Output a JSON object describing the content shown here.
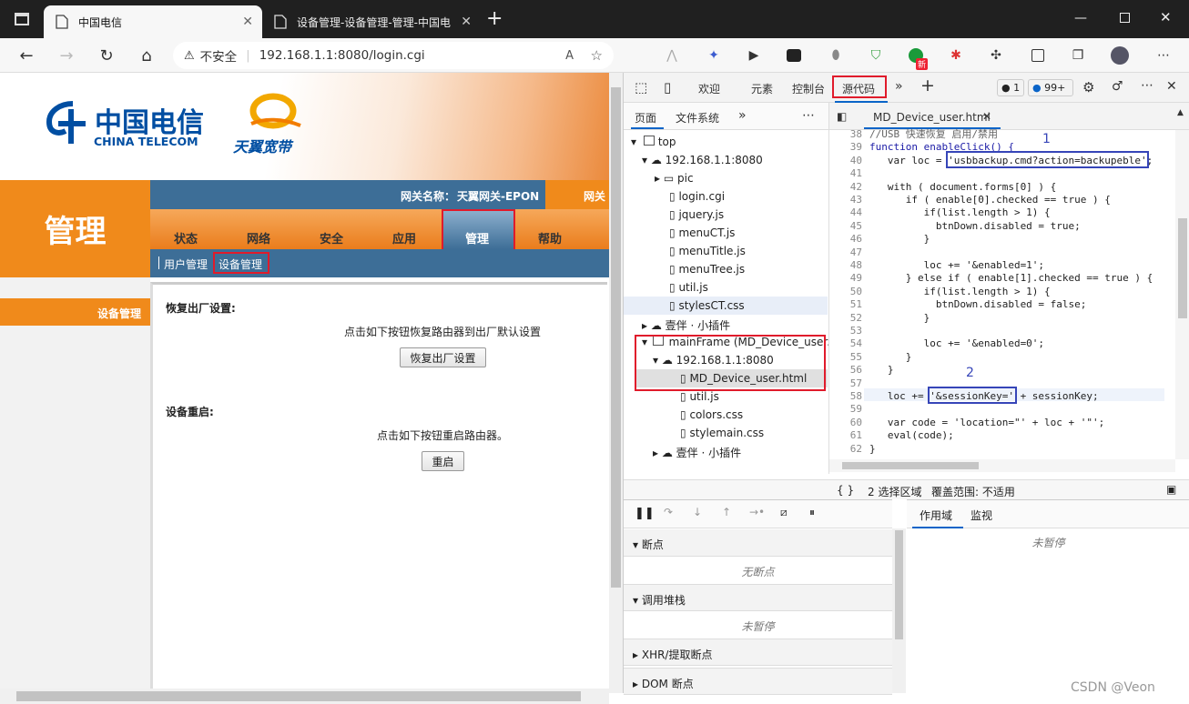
{
  "browser": {
    "tabs": [
      {
        "title": "中国电信"
      },
      {
        "title": "设备管理-设备管理-管理-中国电"
      }
    ],
    "security_label": "不安全",
    "url": "192.168.1.1:8080/login.cgi",
    "read_aloud": "A",
    "ext_badge": "新"
  },
  "page": {
    "logo_cn": "中国电信",
    "logo_en": "CHINA TELECOM",
    "logo2": "天翼宽带",
    "side_title": "管理",
    "gateway_label": "网关名称：",
    "gateway_name": "天翼网关-EPON",
    "gateway_label2": "网关",
    "menu": [
      "状态",
      "网络",
      "安全",
      "应用",
      "管理",
      "帮助"
    ],
    "submenu": [
      "用户管理",
      "设备管理"
    ],
    "sidebar_item": "设备管理",
    "factory_title": "恢复出厂设置:",
    "factory_desc": "点击如下按钮恢复路由器到出厂默认设置",
    "factory_btn": "恢复出厂设置",
    "reboot_title": "设备重启:",
    "reboot_desc": "点击如下按钮重启路由器。",
    "reboot_btn": "重启"
  },
  "devtools": {
    "tabs": [
      "欢迎",
      "元素",
      "控制台",
      "源代码"
    ],
    "error_count": "1",
    "msg_count": "99+",
    "nav_tabs": [
      "页面",
      "文件系统"
    ],
    "tree": [
      "top",
      "192.168.1.1:8080",
      "pic",
      "login.cgi",
      "jquery.js",
      "menuCT.js",
      "menuTitle.js",
      "menuTree.js",
      "util.js",
      "stylesCT.css",
      "壹伴 · 小插件",
      "mainFrame (MD_Device_user.html)",
      "192.168.1.1:8080",
      "MD_Device_user.html",
      "util.js",
      "colors.css",
      "stylemain.css",
      "壹伴 · 小插件"
    ],
    "file_tab": "MD_Device_user.html",
    "line_numbers": [
      "38",
      "39",
      "40",
      "41",
      "42",
      "43",
      "44",
      "45",
      "46",
      "47",
      "48",
      "49",
      "50",
      "51",
      "52",
      "53",
      "54",
      "55",
      "56",
      "57",
      "58",
      "59",
      "60",
      "61",
      "62"
    ],
    "code_lines": [
      "//USB 快速恢复 启用/禁用",
      "function enableClick() {",
      "   var loc = 'usbbackup.cmd?action=backupeble';",
      "",
      "   with ( document.forms[0] ) {",
      "      if ( enable[0].checked == true ) {",
      "         if(list.length > 1) {",
      "           btnDown.disabled = true;",
      "         }",
      "",
      "         loc += '&enabled=1';",
      "      } else if ( enable[1].checked == true ) {",
      "         if(list.length > 1) {",
      "           btnDown.disabled = false;",
      "         }",
      "",
      "         loc += '&enabled=0';",
      "      }",
      "   }",
      "",
      "   loc += '&sessionKey=' + sessionKey;",
      "",
      "   var code = 'location=\"' + loc + '\"';",
      "   eval(code);",
      "}"
    ],
    "annotation1": "1",
    "annotation2": "2",
    "status_braces": "{ }",
    "status_selection": "2 选择区域",
    "status_coverage": "覆盖范围: 不适用",
    "sections": [
      "断点",
      "调用堆栈",
      "XHR/提取断点",
      "DOM 断点"
    ],
    "no_breakpoints": "无断点",
    "not_paused": "未暂停",
    "scope_tabs": [
      "作用域",
      "监视"
    ],
    "scope_not_paused": "未暂停"
  },
  "watermark": "CSDN @Veon"
}
